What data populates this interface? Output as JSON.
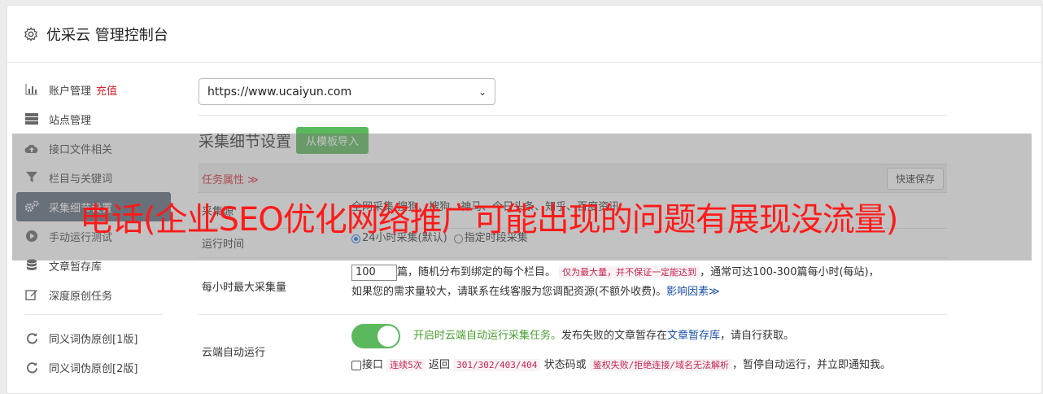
{
  "header": {
    "title": "优采云 管理控制台",
    "icon": "gear-icon"
  },
  "sidebar": {
    "items": [
      {
        "label": "账户管理",
        "badge": "充值",
        "icon": "bar-chart-icon"
      },
      {
        "label": "站点管理",
        "icon": "server-icon"
      },
      {
        "label": "接口文件相关",
        "icon": "cloud-upload-icon"
      },
      {
        "label": "栏目与关键词",
        "icon": "filter-icon"
      },
      {
        "label": "采集细节设置",
        "icon": "gears-icon"
      },
      {
        "label": "手动运行测试",
        "icon": "play-circle-icon"
      },
      {
        "label": "文章暂存库",
        "icon": "database-icon"
      },
      {
        "label": "深度原创任务",
        "icon": "edit-icon"
      },
      {
        "label": "同义词伪原创[1版]",
        "icon": "refresh-icon"
      },
      {
        "label": "同义词伪原创[2版]",
        "icon": "refresh-icon"
      }
    ]
  },
  "main": {
    "site_select": "https://www.ucaiyun.com",
    "section_title": "采集细节设置",
    "import_button": "从模板导入",
    "props_label": "任务属性 ≫",
    "quick_save": "快速保存",
    "row_source": {
      "label": "采集源",
      "value": "全网采集 搜狗、搜狗、神马、今日头条、知乎、百度资讯"
    },
    "row_runtime": {
      "label": "运行时间",
      "opt1": "24小时采集(默认)",
      "opt2": "指定时段采集"
    },
    "row_max": {
      "label": "每小时最大采集量",
      "value": "100",
      "text1": "篇，随机分布到绑定的每个栏目。",
      "code1": "仅为最大量，并不保证一定能达到",
      "text2": "，通常可达100-300篇每小时(每站)，",
      "text3": "如果您的需求量较大，请联系在线客服为您调配资源(不额外收费)。",
      "link": "影响因素≫"
    },
    "row_cloud": {
      "label": "云端自动运行",
      "green": "开启时云端自动运行采集任务。",
      "text1": "发布失败的文章暂存在",
      "link": "文章暂存库",
      "text2": "，请自行获取。",
      "cb_label": "接口",
      "code1": "连续5次",
      "text3": "返回",
      "code2": "301/302/403/404",
      "text4": "状态码或",
      "code3": "鉴权失败/拒绝连接/域名无法解析",
      "text5": "，暂停自动运行，并立即通知我。"
    }
  },
  "overlay": {
    "text": "电话(企业SEO优化网络推广可能出现的问题有展现没流量)"
  },
  "colors": {
    "accent_green": "#5cb85c",
    "active_sidebar": "#5b6b7c",
    "red": "#d9232d",
    "overlay_text": "#ff1a1a"
  }
}
